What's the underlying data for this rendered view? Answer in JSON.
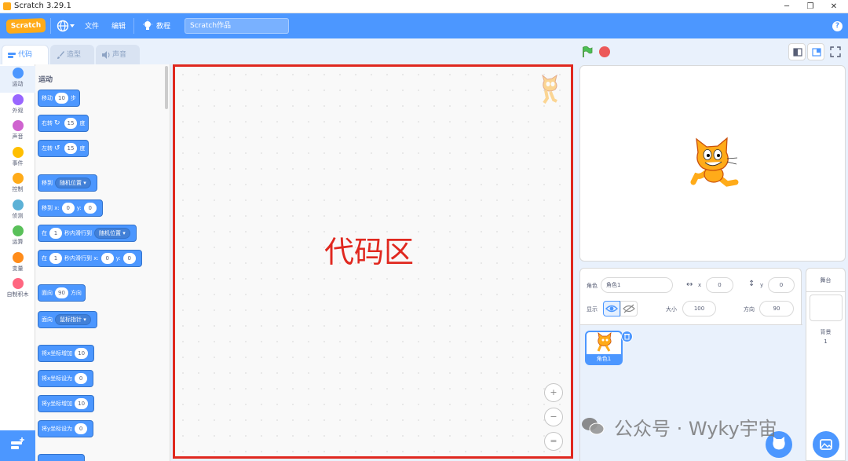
{
  "window": {
    "title": "Scratch 3.29.1",
    "buttons": [
      "─",
      "❐",
      "✕"
    ]
  },
  "menubar": {
    "logo": "Scratch",
    "file": "文件",
    "edit": "编辑",
    "tutorials": "教程",
    "project_title": "Scratch作品",
    "help": "?"
  },
  "tabs": [
    {
      "label": "代码",
      "active": true
    },
    {
      "label": "造型",
      "active": false
    },
    {
      "label": "声音",
      "active": false
    }
  ],
  "categories": [
    {
      "label": "运动",
      "color": "#4c97ff"
    },
    {
      "label": "外观",
      "color": "#9966ff"
    },
    {
      "label": "声音",
      "color": "#cf63cf"
    },
    {
      "label": "事件",
      "color": "#ffbf00"
    },
    {
      "label": "控制",
      "color": "#ffab19"
    },
    {
      "label": "侦测",
      "color": "#5cb1d6"
    },
    {
      "label": "运算",
      "color": "#59c059"
    },
    {
      "label": "变量",
      "color": "#ff8c1a"
    },
    {
      "label": "自制积木",
      "color": "#ff6680"
    }
  ],
  "palette": {
    "section": "运动",
    "blocks": {
      "move": {
        "pre": "移动",
        "val": "10",
        "post": "步"
      },
      "turn_right": {
        "pre": "右转",
        "val": "15",
        "post": "度"
      },
      "turn_left": {
        "pre": "左转",
        "val": "15",
        "post": "度"
      },
      "goto": {
        "pre": "移到",
        "dd": "随机位置"
      },
      "goto_xy": {
        "pre": "移到 x:",
        "x": "0",
        "ylbl": "y:",
        "y": "0"
      },
      "glide": {
        "pre": "在",
        "val": "1",
        "mid": "秒内滑行到",
        "dd": "随机位置"
      },
      "glide_xy": {
        "pre": "在",
        "val": "1",
        "mid": "秒内滑行到 x:",
        "x": "0",
        "ylbl": "y:",
        "y": "0"
      },
      "point_dir": {
        "pre": "面向",
        "val": "90",
        "post": "方向"
      },
      "point_towards": {
        "pre": "面向",
        "dd": "鼠标指针"
      },
      "change_x": {
        "pre": "将x坐标增加",
        "val": "10"
      },
      "set_x": {
        "pre": "将x坐标设为",
        "val": "0"
      },
      "change_y": {
        "pre": "将y坐标增加",
        "val": "10"
      },
      "set_y": {
        "pre": "将y坐标设为",
        "val": "0"
      }
    }
  },
  "code_area": {
    "label": "代码区",
    "zoom_in": "+",
    "zoom_out": "−",
    "reset": "="
  },
  "sprite_info": {
    "sprite_label": "角色",
    "sprite_name": "角色1",
    "x": "0",
    "y_label": "y",
    "y": "0",
    "show_label": "显示",
    "size_label": "大小",
    "size": "100",
    "direction_label": "方向",
    "direction": "90"
  },
  "sprite_list": [
    {
      "name": "角色1"
    }
  ],
  "stage_panel": {
    "title": "舞台",
    "backdrop_label": "背景",
    "backdrop_count": "1"
  },
  "watermark": "公众号 · Wyky宇宙"
}
